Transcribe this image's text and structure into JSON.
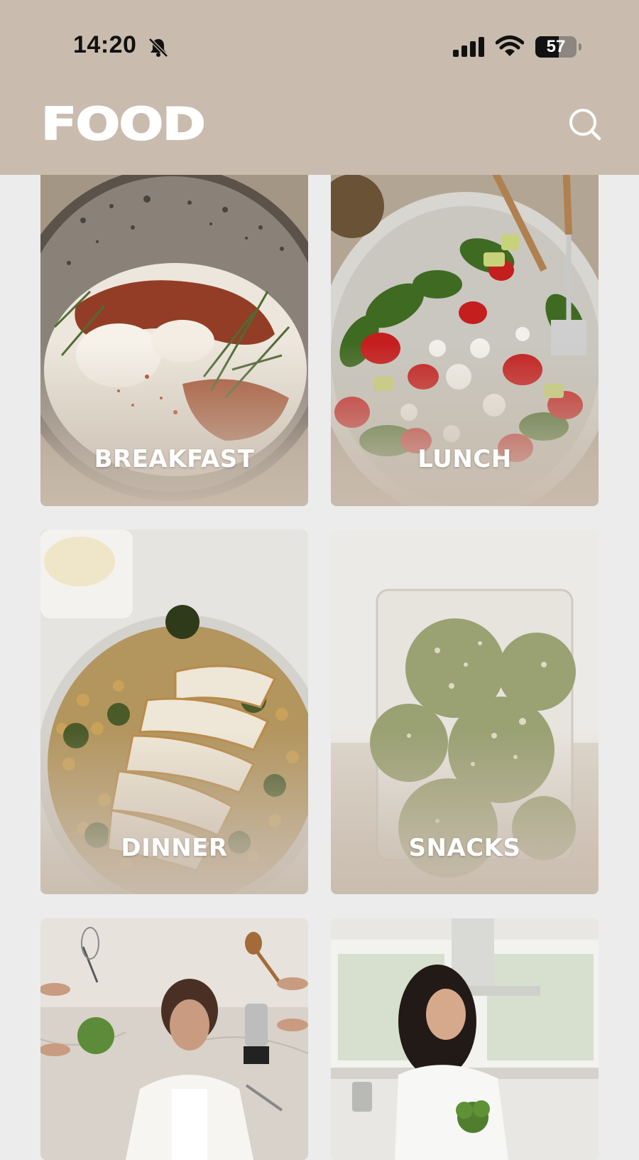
{
  "status_bar": {
    "time": "14:20",
    "battery": "57",
    "battery_level": 0.57,
    "icons": [
      "bell-slash-icon",
      "cellular-signal-icon",
      "wifi-icon",
      "battery-icon"
    ]
  },
  "header": {
    "logo": "FOOD",
    "search_icon": "search-icon"
  },
  "colors": {
    "header_bg": "#c9bcae",
    "page_bg": "#ececec",
    "label_text": "#ffffff"
  },
  "categories": [
    {
      "label": "BREAKFAST",
      "image": "eggs-yogurt-dill-photo"
    },
    {
      "label": "LUNCH",
      "image": "spinach-strawberry-salad-photo"
    },
    {
      "label": "DINNER",
      "image": "chicken-chickpea-bowl-photo"
    },
    {
      "label": "SNACKS",
      "image": "matcha-energy-balls-photo"
    },
    {
      "label": "",
      "image": "woman-cooking-kitchen-photo"
    },
    {
      "label": "",
      "image": "woman-with-broccoli-photo"
    }
  ]
}
